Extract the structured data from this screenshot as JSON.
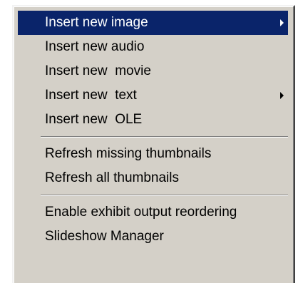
{
  "menu": {
    "items": [
      {
        "label": "Insert new image",
        "submenu": true,
        "selected": true
      },
      {
        "label": "Insert new audio"
      },
      {
        "label": "Insert new  movie"
      },
      {
        "label": "Insert new  text",
        "submenu": true
      },
      {
        "label": "Insert new  OLE"
      },
      {
        "label": "Refresh missing thumbnails"
      },
      {
        "label": "Refresh all thumbnails"
      },
      {
        "label": "Enable exhibit output reordering"
      },
      {
        "label": "Slideshow Manager"
      }
    ],
    "icons": {
      "submenu": "chevron-right-icon"
    },
    "colors": {
      "background": "#d4d0c8",
      "highlight": "#0a246a",
      "highlight_text": "#ffffff",
      "text": "#000000"
    }
  }
}
